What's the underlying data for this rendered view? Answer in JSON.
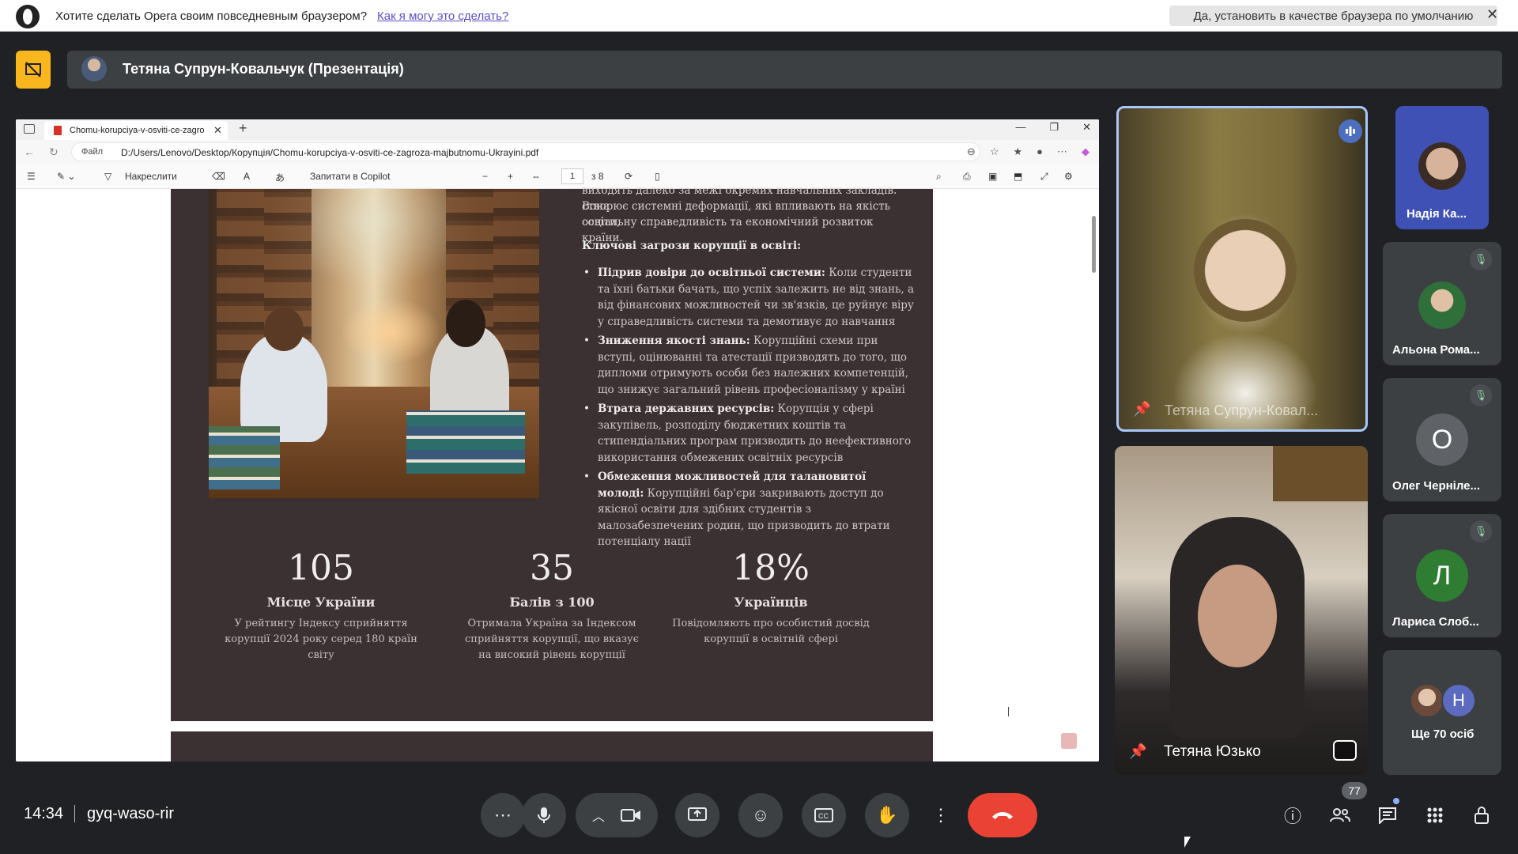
{
  "opera": {
    "prompt": "Хотите сделать Opera своим повседневным браузером?",
    "how_link": "Как я могу это сделать?",
    "default_button": "Да, установить в качестве браузера по умолчанию",
    "close": "✕"
  },
  "meet": {
    "presentation_title": "Тетяна Супрун-Ковальчук (Презентація)",
    "time": "14:34",
    "meeting_code": "gyq-waso-rir",
    "people_count": "77"
  },
  "browser": {
    "tab_title": "Chomu-korupciya-v-osviti-ce-zagroza-majbutnomu-Ukrayini.pdf",
    "url_label": "Файл",
    "url": "D:/Users/Lenovo/Desktop/Корупція/Chomu-korupciya-v-osviti-ce-zagroza-majbutnomu-Ukrayini.pdf",
    "toolbar": {
      "draw": "Накреслити",
      "copilot": "Запитати в Copilot",
      "page": "1",
      "page_total": "з 8"
    }
  },
  "pdf": {
    "intro_line1": "виходять далеко за межі окремих навчальних закладів. Вона",
    "intro_line2": "створює системні деформації, які впливають на якість освіти,",
    "intro_line3": "соціальну справедливість та економічний розвиток країни.",
    "threats_heading": "Ключові загрози корупції в освіті:",
    "threats": [
      {
        "title": "Підрив довіри до освітньої системи:",
        "text": "Коли студенти та їхні батьки бачать, що успіх залежить не від знань, а від фінансових можливостей чи зв'язків, це руйнує віру у справедливість системи та демотивує до навчання"
      },
      {
        "title": "Зниження якості знань:",
        "text": "Корупційні схеми при вступі, оцінюванні та атестації призводять до того, що дипломи отримують особи без належних компетенцій, що знижує загальний рівень професіоналізму у країні"
      },
      {
        "title": "Втрата державних ресурсів:",
        "text": "Корупція у сфері закупівель, розподілу бюджетних коштів та стипендіальних програм призводить до неефективного використання обмежених освітніх ресурсів"
      },
      {
        "title": "Обмеження можливостей для талановитої молоді:",
        "text": "Корупційні бар'єри закривають доступ до якісної освіти для здібних студентів з малозабезпечених родин, що призводить до втрати потенціалу нації"
      }
    ],
    "stats": [
      {
        "number": "105",
        "label": "Місце України",
        "desc": "У рейтингу Індексу сприйняття корупції 2024 року серед 180 країн світу"
      },
      {
        "number": "35",
        "label": "Балів з 100",
        "desc": "Отримала Україна за Індексом сприйняття корупції, що вказує на високий рівень корупції"
      },
      {
        "number": "18%",
        "label": "Українців",
        "desc": "Повідомляють про особистий досвід корупції в освітній сфері"
      }
    ]
  },
  "participants": {
    "speaker": "Тетяна Супрун-Ковал...",
    "second": "Тетяна Юзько",
    "side": [
      {
        "name": "Надія Ка...",
        "avatar": ""
      },
      {
        "name": "Альона Рома...",
        "avatar": ""
      },
      {
        "name": "Олег Черніле...",
        "avatar": "О"
      },
      {
        "name": "Лариса Слоб...",
        "avatar": "Л"
      }
    ],
    "more": "Ще 70 осіб",
    "more_letter": "Н"
  },
  "colors": {
    "meet_bg": "#202124",
    "present_badge": "#f9b71d",
    "end_call": "#ea4335",
    "pdf_page": "#3b3032"
  }
}
